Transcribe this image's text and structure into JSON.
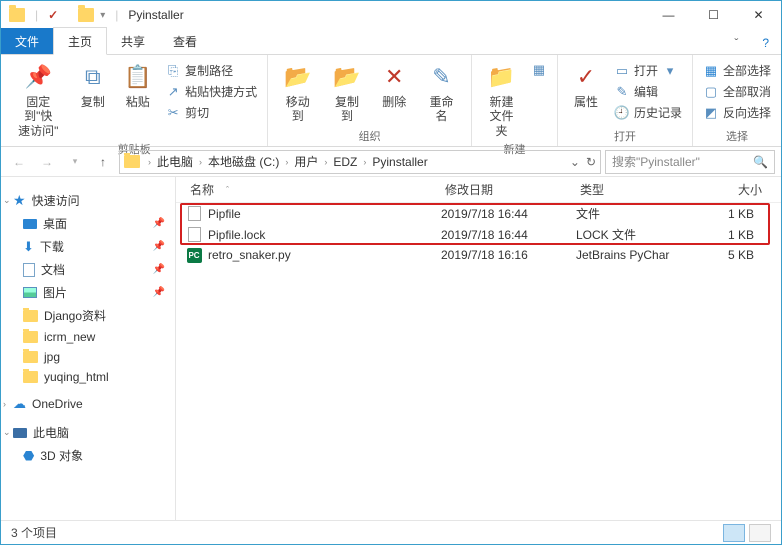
{
  "window": {
    "title": "Pyinstaller"
  },
  "tabs": {
    "file": "文件",
    "home": "主页",
    "share": "共享",
    "view": "查看"
  },
  "ribbon": {
    "clipboard": {
      "pin": "固定到\"快\n速访问\"",
      "copy": "复制",
      "paste": "粘贴",
      "cut": "剪切",
      "copypath": "复制路径",
      "pasteshortcut": "粘贴快捷方式",
      "group": "剪贴板"
    },
    "organize": {
      "moveto": "移动到",
      "copyto": "复制到",
      "delete": "删除",
      "rename": "重命名",
      "group": "组织"
    },
    "new": {
      "newfolder": "新建\n文件夹",
      "group": "新建"
    },
    "open": {
      "properties": "属性",
      "open": "打开",
      "edit": "编辑",
      "history": "历史记录",
      "group": "打开"
    },
    "select": {
      "selectall": "全部选择",
      "selectnone": "全部取消",
      "invert": "反向选择",
      "group": "选择"
    }
  },
  "breadcrumbs": [
    "此电脑",
    "本地磁盘 (C:)",
    "用户",
    "EDZ",
    "Pyinstaller"
  ],
  "search": {
    "placeholder": "搜索\"Pyinstaller\""
  },
  "sidebar": {
    "quick": "快速访问",
    "items": [
      "桌面",
      "下载",
      "文档",
      "图片",
      "Django资料",
      "icrm_new",
      "jpg",
      "yuqing_html"
    ],
    "onedrive": "OneDrive",
    "thispc": "此电脑",
    "threeD": "3D 对象"
  },
  "columns": {
    "name": "名称",
    "date": "修改日期",
    "type": "类型",
    "size": "大小"
  },
  "files": [
    {
      "name": "Pipfile",
      "date": "2019/7/18 16:44",
      "type": "文件",
      "size": "1 KB",
      "icon": "file"
    },
    {
      "name": "Pipfile.lock",
      "date": "2019/7/18 16:44",
      "type": "LOCK 文件",
      "size": "1 KB",
      "icon": "file"
    },
    {
      "name": "retro_snaker.py",
      "date": "2019/7/18 16:16",
      "type": "JetBrains PyChar",
      "size": "5 KB",
      "icon": "py"
    }
  ],
  "status": {
    "count": "3 个项目"
  }
}
